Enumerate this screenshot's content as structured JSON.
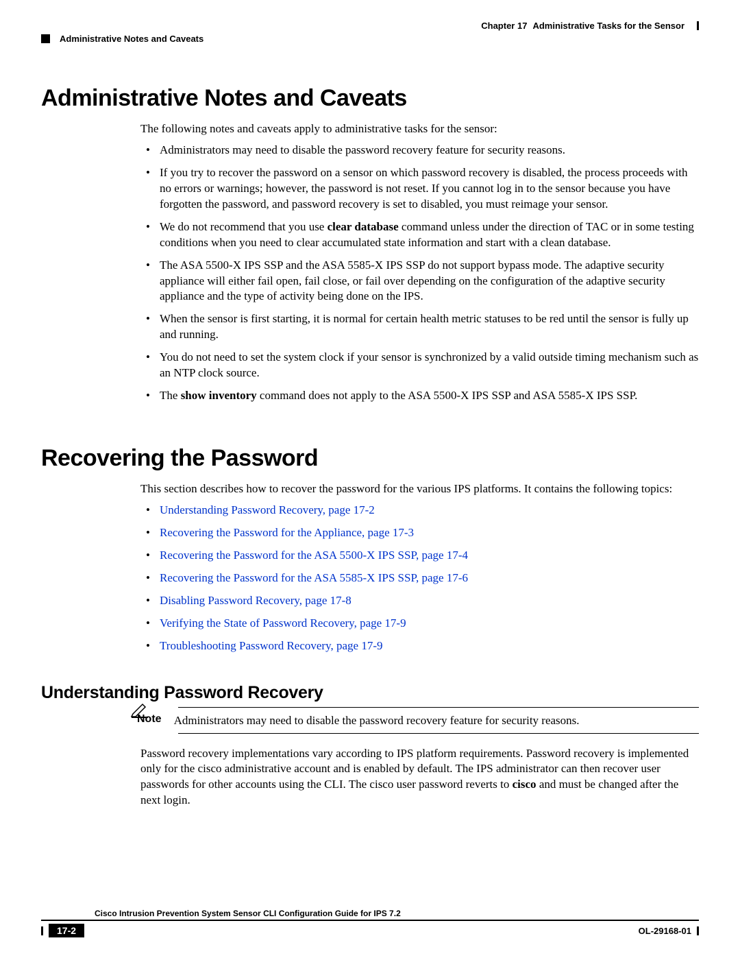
{
  "header": {
    "chapter": "Chapter 17",
    "chapter_title": "Administrative Tasks for the Sensor",
    "running_head": "Administrative Notes and Caveats"
  },
  "section1": {
    "title": "Administrative Notes and Caveats",
    "intro": "The following notes and caveats apply to administrative tasks for the sensor:",
    "b1": "Administrators may need to disable the password recovery feature for security reasons.",
    "b2": "If you try to recover the password on a sensor on which password recovery is disabled, the process proceeds with no errors or warnings; however, the password is not reset. If you cannot log in to the sensor because you have forgotten the password, and password recovery is set to disabled, you must reimage your sensor.",
    "b3_pre": "We do not recommend that you use ",
    "b3_bold": "clear database",
    "b3_post": " command unless under the direction of TAC or in some testing conditions when you need to clear accumulated state information and start with a clean database.",
    "b4": "The ASA 5500-X IPS SSP and the ASA 5585-X IPS SSP do not support bypass mode. The adaptive security appliance will either fail open, fail close, or fail over depending on the configuration of the adaptive security appliance and the type of activity being done on the IPS.",
    "b5": "When the sensor is first starting, it is normal for certain health metric statuses to be red until the sensor is fully up and running.",
    "b6": "You do not need to set the system clock if your sensor is synchronized by a valid outside timing mechanism such as an NTP clock source.",
    "b7_pre": "The ",
    "b7_bold": "show inventory",
    "b7_post": " command does not apply to the ASA 5500-X IPS SSP and ASA 5585-X IPS SSP."
  },
  "section2": {
    "title": "Recovering the Password",
    "intro": "This section describes how to recover the password for the various IPS platforms. It contains the following topics:",
    "l1": "Understanding Password Recovery, page 17-2",
    "l2": "Recovering the Password for the Appliance, page 17-3",
    "l3": "Recovering the Password for the ASA 5500-X IPS SSP, page 17-4",
    "l4": "Recovering the Password for the ASA 5585-X IPS SSP, page 17-6",
    "l5": "Disabling Password Recovery, page 17-8",
    "l6": "Verifying the State of Password Recovery, page 17-9",
    "l7": "Troubleshooting Password Recovery, page 17-9"
  },
  "section3": {
    "title": "Understanding Password Recovery",
    "note_label": "Note",
    "note_text": "Administrators may need to disable the password recovery feature for security reasons.",
    "p_pre": "Password recovery implementations vary according to IPS platform requirements. Password recovery is implemented only for the cisco administrative account and is enabled by default. The IPS administrator can then recover user passwords for other accounts using the CLI. The cisco user password reverts to ",
    "p_bold": "cisco",
    "p_post": " and must be changed after the next login."
  },
  "footer": {
    "guide_title": "Cisco Intrusion Prevention System Sensor CLI Configuration Guide for IPS 7.2",
    "page_number": "17-2",
    "doc_id": "OL-29168-01"
  }
}
